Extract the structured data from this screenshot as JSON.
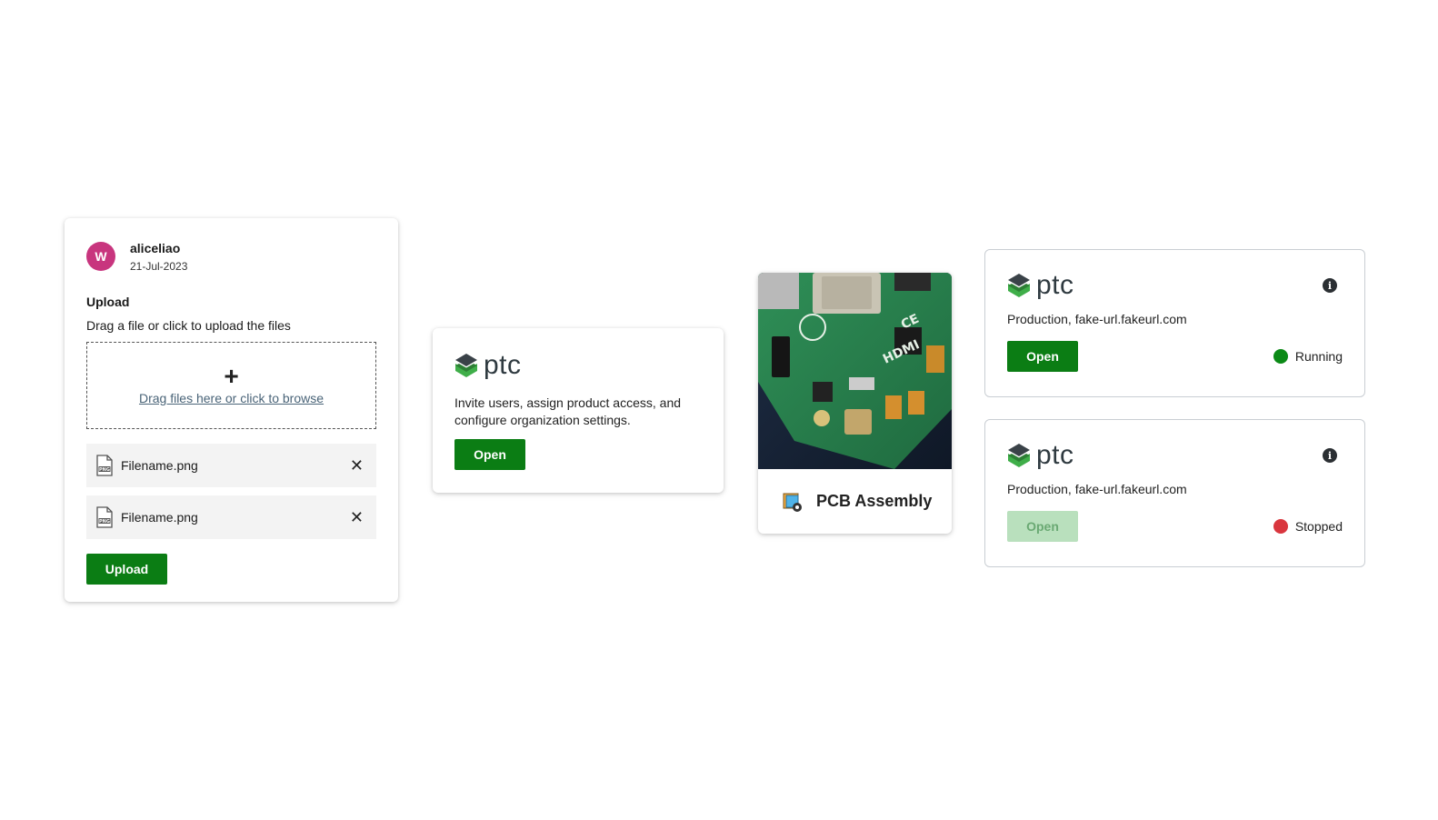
{
  "upload_card": {
    "avatar_initial": "W",
    "username": "aliceliao",
    "date": "21-Jul-2023",
    "title": "Upload",
    "description": "Drag a file or click to upload the files",
    "dropzone_icon": "plus-icon",
    "dropzone_link": "Drag files here or click to browse",
    "files": [
      {
        "name": "Filename.png",
        "icon": "png-file-icon"
      },
      {
        "name": "Filename.png",
        "icon": "png-file-icon"
      }
    ],
    "upload_label": "Upload",
    "colors": {
      "avatar": "#c8357e",
      "primary": "#0b7d14"
    }
  },
  "invite_card": {
    "logo_text": "ptc",
    "description": "Invite users, assign product access, and configure organization settings.",
    "open_label": "Open"
  },
  "pcb_card": {
    "image": "raspberry-pi-board-photo",
    "icon": "assembly-icon",
    "title": "PCB Assembly"
  },
  "servers": [
    {
      "logo_text": "ptc",
      "url": "Production, fake-url.fakeurl.com",
      "open_label": "Open",
      "open_enabled": true,
      "status": "Running",
      "status_color": "#0b8a16"
    },
    {
      "logo_text": "ptc",
      "url": "Production, fake-url.fakeurl.com",
      "open_label": "Open",
      "open_enabled": false,
      "status": "Stopped",
      "status_color": "#d9363e"
    }
  ]
}
